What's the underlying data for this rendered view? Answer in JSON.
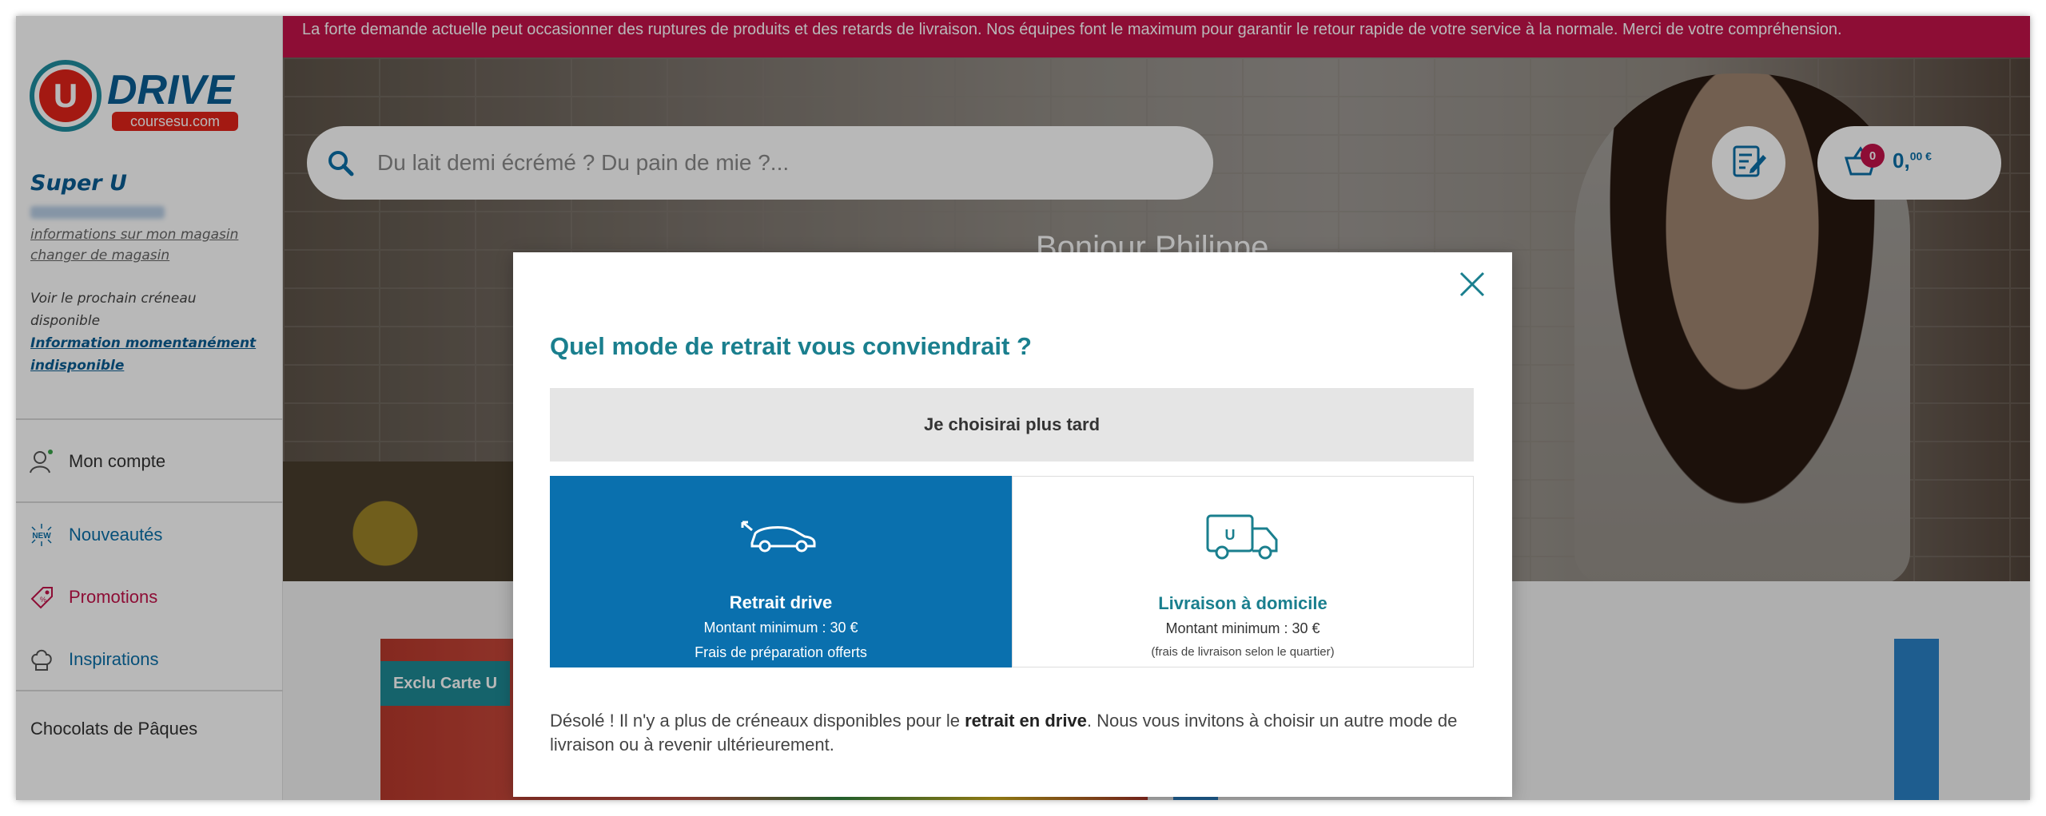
{
  "alert": {
    "text": "La forte demande actuelle peut occasionner des ruptures de produits et des retards de livraison. Nos équipes font le maximum pour garantir le retour rapide de votre service à la normale. Merci de votre compréhension."
  },
  "logo": {
    "letter": "U",
    "brand": "DRIVE",
    "sub": "coursesu.com"
  },
  "sidebar": {
    "store_name": "Super U",
    "store_info_link": "informations sur mon magasin",
    "change_store_link": "changer de magasin",
    "slot_text": "Voir le prochain créneau disponible",
    "slot_info": "Information momentanément indisponible",
    "menu": [
      {
        "label": "Mon compte",
        "icon": "user-icon",
        "color": "#333333"
      },
      {
        "label": "Nouveautés",
        "icon": "new-icon",
        "color": "#0b6fa8"
      },
      {
        "label": "Promotions",
        "icon": "tag-icon",
        "color": "#c4124a"
      },
      {
        "label": "Inspirations",
        "icon": "chef-hat-icon",
        "color": "#0b6fa8"
      },
      {
        "label": "Chocolats de Pâques",
        "color": "#333333"
      }
    ]
  },
  "header": {
    "search_placeholder": "Du lait demi écrémé ? Du pain de mie ?...",
    "greeting": "Bonjour Philippe",
    "cart_count": "0",
    "cart_total_main": "0,",
    "cart_total_cents": "00 €"
  },
  "content": {
    "card_badge": "Exclu Carte U"
  },
  "modal": {
    "title": "Quel mode de retrait vous conviendrait ?",
    "later_label": "Je choisirai plus tard",
    "options": [
      {
        "title": "Retrait drive",
        "line1": "Montant minimum : 30 €",
        "line2": "Frais de préparation offerts",
        "icon": "car-icon"
      },
      {
        "title": "Livraison à domicile",
        "line1": "Montant minimum : 30 €",
        "line2": "(frais de livraison selon le quartier)",
        "icon": "truck-icon"
      }
    ],
    "msg_before": "Désolé ! Il n'y a plus de créneaux disponibles pour le ",
    "msg_bold": "retrait en drive",
    "msg_after": ". Nous vous invitons à choisir un autre mode de livraison ou à revenir ultérieurement."
  },
  "colors": {
    "accent": "#0a70ae",
    "teal": "#1a7f8e",
    "alert": "#c4124a"
  }
}
